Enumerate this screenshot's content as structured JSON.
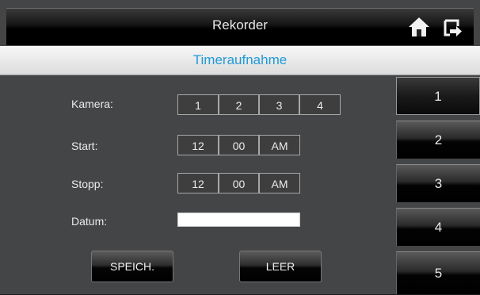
{
  "header": {
    "title": "Rekorder",
    "home_icon": "home-icon",
    "back_icon": "exit-arrow-icon"
  },
  "subheader": {
    "title": "Timeraufnahme",
    "color": "#1e9ad6"
  },
  "form": {
    "camera": {
      "label": "Kamera:",
      "options": [
        "1",
        "2",
        "3",
        "4"
      ]
    },
    "start": {
      "label": "Start:",
      "hour": "12",
      "minute": "00",
      "ampm": "AM"
    },
    "stop": {
      "label": "Stopp:",
      "hour": "12",
      "minute": "00",
      "ampm": "AM"
    },
    "date": {
      "label": "Datum:",
      "value": ""
    }
  },
  "buttons": {
    "save": "SPEICH.",
    "clear": "LEER"
  },
  "camera_tabs": [
    "1",
    "2",
    "3",
    "4",
    "5"
  ],
  "selected_camera_tab": "1"
}
